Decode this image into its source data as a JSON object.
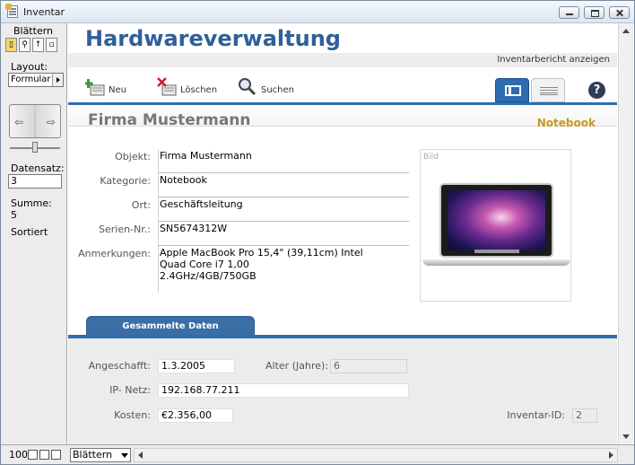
{
  "window": {
    "title": "Inventar"
  },
  "status_area": {
    "mode_label": "Blättern",
    "layout_label": "Layout:",
    "layout_value": "Formular",
    "record_label": "Datensatz:",
    "record_value": "3",
    "total_label": "Summe:",
    "total_value": "5",
    "sort_status": "Sortiert"
  },
  "bottom_bar": {
    "zoom": "100",
    "mode_value": "Blättern"
  },
  "header": {
    "app_title": "Hardwareverwaltung",
    "report_link": "Inventarbericht anzeigen"
  },
  "toolbar": {
    "new_label": "Neu",
    "delete_label": "Löschen",
    "search_label": "Suchen",
    "help_label": "?"
  },
  "record": {
    "title": "Firma Mustermann",
    "category_badge": "Notebook",
    "fields": {
      "object_label": "Objekt:",
      "object_value": "Firma Mustermann",
      "category_label": "Kategorie:",
      "category_value": "Notebook",
      "location_label": "Ort:",
      "location_value": "Geschäftsleitung",
      "serial_label": "Serien-Nr.:",
      "serial_value": "SN5674312W",
      "notes_label": "Anmerkungen:",
      "notes_line1": "Apple MacBook Pro 15,4\" (39,11cm) Intel",
      "notes_line2": "Quad Core i7 1,00",
      "notes_line3": "2.4GHz/4GB/750GB"
    },
    "image_label": "Bild"
  },
  "tab": {
    "label": "Gesammelte Daten"
  },
  "collected": {
    "purchased_label": "Angeschafft:",
    "purchased_value": "1.3.2005",
    "age_label": "Alter (Jahre):",
    "age_value": "6",
    "ip_label": "IP- Netz:",
    "ip_value": "192.168.77.211",
    "cost_label": "Kosten:",
    "cost_value": "€2.356,00",
    "inventory_id_label": "Inventar-ID:",
    "inventory_id_value": "2"
  },
  "colors": {
    "accent_blue": "#2f6bb0",
    "title_blue": "#2f5f9a",
    "badge_gold": "#c99a1e"
  }
}
